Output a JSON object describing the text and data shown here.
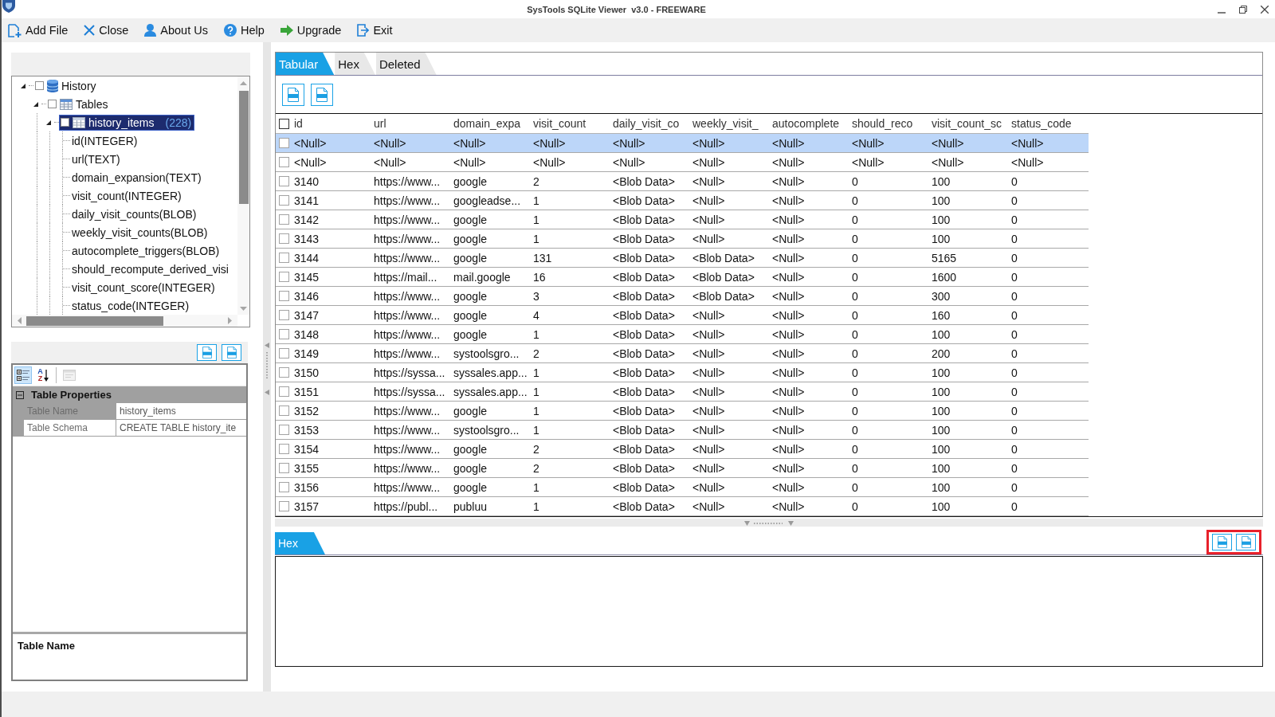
{
  "window": {
    "title": "SysTools SQLite Viewer  v3.0 - FREEWARE"
  },
  "toolbar": [
    {
      "kind": "add-file",
      "label": "Add File"
    },
    {
      "kind": "close",
      "label": "Close"
    },
    {
      "kind": "about",
      "label": "About Us"
    },
    {
      "kind": "help",
      "label": "Help"
    },
    {
      "kind": "upgrade",
      "label": "Upgrade"
    },
    {
      "kind": "exit",
      "label": "Exit"
    }
  ],
  "tree": [
    {
      "label": "History",
      "kind": "database",
      "checked": false,
      "expanded": true,
      "selected": false,
      "children": [
        {
          "label": "Tables",
          "kind": "tables",
          "checked": false,
          "expanded": true,
          "selected": false,
          "children": [
            {
              "label": "history_items",
              "count": "(228)",
              "kind": "table",
              "checked": false,
              "expanded": true,
              "selected": true,
              "children": [
                {
                  "label": "id(INTEGER)",
                  "kind": "column",
                  "selected": false
                },
                {
                  "label": "url(TEXT)",
                  "kind": "column",
                  "selected": false
                },
                {
                  "label": "domain_expansion(TEXT)",
                  "kind": "column",
                  "selected": false
                },
                {
                  "label": "visit_count(INTEGER)",
                  "kind": "column",
                  "selected": false
                },
                {
                  "label": "daily_visit_counts(BLOB)",
                  "kind": "column",
                  "selected": false
                },
                {
                  "label": "weekly_visit_counts(BLOB)",
                  "kind": "column",
                  "selected": false
                },
                {
                  "label": "autocomplete_triggers(BLOB)",
                  "kind": "column",
                  "selected": false
                },
                {
                  "label": "should_recompute_derived_visi",
                  "kind": "column",
                  "selected": false
                },
                {
                  "label": "visit_count_score(INTEGER)",
                  "kind": "column",
                  "selected": false
                },
                {
                  "label": "status_code(INTEGER)",
                  "kind": "column",
                  "selected": false
                }
              ]
            }
          ]
        }
      ]
    }
  ],
  "properties": {
    "toolbar": [
      {
        "kind": "categorized",
        "selected": true,
        "disabled": false
      },
      {
        "kind": "alphabetical",
        "letters": [
          "A",
          "Z"
        ],
        "selected": false,
        "disabled": false
      },
      {
        "kind": "property-pages",
        "selected": false,
        "disabled": true
      }
    ],
    "category": {
      "label": "Table Properties",
      "expanded": true
    },
    "rows": [
      {
        "name": "Table Name",
        "value": "history_items",
        "selected": true
      },
      {
        "name": "Table Schema",
        "value": "CREATE TABLE history_ite",
        "selected": false
      }
    ],
    "description": {
      "title": "Table Name"
    }
  },
  "tabs": [
    {
      "label": "Tabular",
      "selected": true
    },
    {
      "label": "Hex",
      "selected": false
    },
    {
      "label": "Deleted",
      "selected": false
    }
  ],
  "table": {
    "all_checked": false,
    "columns": [
      "id",
      "url",
      "domain_expa",
      "visit_count",
      "daily_visit_co",
      "weekly_visit_",
      "autocomplete",
      "should_reco",
      "visit_count_sc",
      "status_code"
    ],
    "rows": [
      {
        "checked": false,
        "selected": true,
        "cells": [
          "<Null>",
          "<Null>",
          "<Null>",
          "<Null>",
          "<Null>",
          "<Null>",
          "<Null>",
          "<Null>",
          "<Null>",
          "<Null>"
        ]
      },
      {
        "checked": false,
        "selected": false,
        "cells": [
          "<Null>",
          "<Null>",
          "<Null>",
          "<Null>",
          "<Null>",
          "<Null>",
          "<Null>",
          "<Null>",
          "<Null>",
          "<Null>"
        ]
      },
      {
        "checked": false,
        "selected": false,
        "cells": [
          "3140",
          "https://www...",
          "google",
          "2",
          "<Blob Data>",
          "<Null>",
          "<Null>",
          "0",
          "100",
          "0"
        ]
      },
      {
        "checked": false,
        "selected": false,
        "cells": [
          "3141",
          "https://www...",
          "googleadse...",
          "1",
          "<Blob Data>",
          "<Null>",
          "<Null>",
          "0",
          "100",
          "0"
        ]
      },
      {
        "checked": false,
        "selected": false,
        "cells": [
          "3142",
          "https://www...",
          "google",
          "1",
          "<Blob Data>",
          "<Null>",
          "<Null>",
          "0",
          "100",
          "0"
        ]
      },
      {
        "checked": false,
        "selected": false,
        "cells": [
          "3143",
          "https://www...",
          "google",
          "1",
          "<Blob Data>",
          "<Null>",
          "<Null>",
          "0",
          "100",
          "0"
        ]
      },
      {
        "checked": false,
        "selected": false,
        "cells": [
          "3144",
          "https://www...",
          "google",
          "131",
          "<Blob Data>",
          "<Blob Data>",
          "<Null>",
          "0",
          "5165",
          "0"
        ]
      },
      {
        "checked": false,
        "selected": false,
        "cells": [
          "3145",
          "https://mail...",
          "mail.google",
          "16",
          "<Blob Data>",
          "<Blob Data>",
          "<Null>",
          "0",
          "1600",
          "0"
        ]
      },
      {
        "checked": false,
        "selected": false,
        "cells": [
          "3146",
          "https://www...",
          "google",
          "3",
          "<Blob Data>",
          "<Blob Data>",
          "<Null>",
          "0",
          "300",
          "0"
        ]
      },
      {
        "checked": false,
        "selected": false,
        "cells": [
          "3147",
          "https://www...",
          "google",
          "4",
          "<Blob Data>",
          "<Null>",
          "<Null>",
          "0",
          "160",
          "0"
        ]
      },
      {
        "checked": false,
        "selected": false,
        "cells": [
          "3148",
          "https://www...",
          "google",
          "1",
          "<Blob Data>",
          "<Null>",
          "<Null>",
          "0",
          "100",
          "0"
        ]
      },
      {
        "checked": false,
        "selected": false,
        "cells": [
          "3149",
          "https://www...",
          "systoolsgro...",
          "2",
          "<Blob Data>",
          "<Null>",
          "<Null>",
          "0",
          "200",
          "0"
        ]
      },
      {
        "checked": false,
        "selected": false,
        "cells": [
          "3150",
          "https://syssa...",
          "syssales.app...",
          "1",
          "<Blob Data>",
          "<Null>",
          "<Null>",
          "0",
          "100",
          "0"
        ]
      },
      {
        "checked": false,
        "selected": false,
        "cells": [
          "3151",
          "https://syssa...",
          "syssales.app...",
          "1",
          "<Blob Data>",
          "<Null>",
          "<Null>",
          "0",
          "100",
          "0"
        ]
      },
      {
        "checked": false,
        "selected": false,
        "cells": [
          "3152",
          "https://www...",
          "google",
          "1",
          "<Blob Data>",
          "<Null>",
          "<Null>",
          "0",
          "100",
          "0"
        ]
      },
      {
        "checked": false,
        "selected": false,
        "cells": [
          "3153",
          "https://www...",
          "systoolsgro...",
          "1",
          "<Blob Data>",
          "<Null>",
          "<Null>",
          "0",
          "100",
          "0"
        ]
      },
      {
        "checked": false,
        "selected": false,
        "cells": [
          "3154",
          "https://www...",
          "google",
          "2",
          "<Blob Data>",
          "<Null>",
          "<Null>",
          "0",
          "100",
          "0"
        ]
      },
      {
        "checked": false,
        "selected": false,
        "cells": [
          "3155",
          "https://www...",
          "google",
          "2",
          "<Blob Data>",
          "<Null>",
          "<Null>",
          "0",
          "100",
          "0"
        ]
      },
      {
        "checked": false,
        "selected": false,
        "cells": [
          "3156",
          "https://www...",
          "google",
          "1",
          "<Blob Data>",
          "<Null>",
          "<Null>",
          "0",
          "100",
          "0"
        ]
      },
      {
        "checked": false,
        "selected": false,
        "cells": [
          "3157",
          "https://publ...",
          "publuu",
          "1",
          "<Blob Data>",
          "<Null>",
          "<Null>",
          "0",
          "100",
          "0"
        ]
      }
    ]
  },
  "hex_panel": {
    "tabs": [
      {
        "label": "Hex",
        "selected": true
      }
    ],
    "export_highlighted": true
  }
}
